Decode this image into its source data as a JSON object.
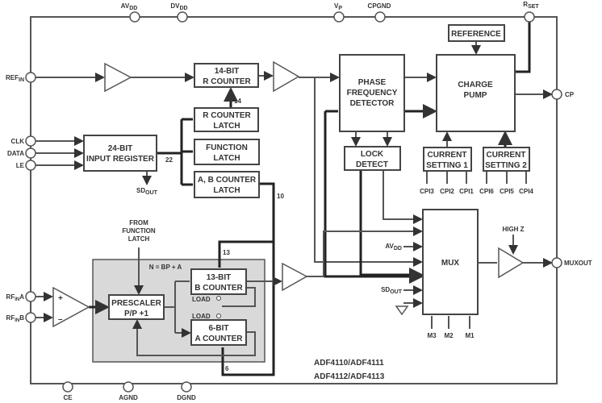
{
  "pins": {
    "avdd": {
      "main": "AV",
      "sub": "DD"
    },
    "dvdd": {
      "main": "DV",
      "sub": "DD"
    },
    "vp": {
      "main": "V",
      "sub": "P"
    },
    "cpgnd": "CPGND",
    "rset": {
      "main": "R",
      "sub": "SET"
    },
    "refin": {
      "main": "REF",
      "sub": "IN"
    },
    "clk": "CLK",
    "data": "DATA",
    "le": "LE",
    "rfina": {
      "main": "RF",
      "sub": "IN",
      "suffix": "A"
    },
    "rfinb": {
      "main": "RF",
      "sub": "IN",
      "suffix": "B"
    },
    "ce": "CE",
    "agnd": "AGND",
    "dgnd": "DGND",
    "cp": "CP",
    "muxout": "MUXOUT"
  },
  "blocks": {
    "r_counter": [
      "14-BIT",
      "R COUNTER"
    ],
    "r_latch": [
      "R COUNTER",
      "LATCH"
    ],
    "function_latch": [
      "FUNCTION",
      "LATCH"
    ],
    "ab_latch": [
      "A, B COUNTER",
      "LATCH"
    ],
    "input_register": [
      "24-BIT",
      "INPUT REGISTER"
    ],
    "pfd": [
      "PHASE",
      "FREQUENCY",
      "DETECTOR"
    ],
    "charge_pump": [
      "CHARGE",
      "PUMP"
    ],
    "reference": "REFERENCE",
    "lock_detect": [
      "LOCK",
      "DETECT"
    ],
    "current_setting_1": [
      "CURRENT",
      "SETTING 1"
    ],
    "current_setting_2": [
      "CURRENT",
      "SETTING 2"
    ],
    "mux": "MUX",
    "prescaler": [
      "PRESCALER",
      "P/P +1"
    ],
    "b_counter": [
      "13-BIT",
      "B COUNTER"
    ],
    "a_counter": [
      "6-BIT",
      "A COUNTER"
    ]
  },
  "labels": {
    "bus_14": "14",
    "bus_22": "22",
    "bus_10": "10",
    "bus_13": "13",
    "bus_6": "6",
    "sdout_reg": {
      "main": "SD",
      "sub": "OUT"
    },
    "sdout_mux": {
      "main": "SD",
      "sub": "OUT"
    },
    "avdd_mux": {
      "main": "AV",
      "sub": "DD"
    },
    "cpi": [
      "CPI3",
      "CPI2",
      "CPI1",
      "CPI6",
      "CPI5",
      "CPI4"
    ],
    "m": [
      "M3",
      "M2",
      "M1"
    ],
    "high_z": "HIGH Z",
    "from_function_latch": [
      "FROM",
      "FUNCTION",
      "LATCH"
    ],
    "n_formula": "N = BP + A",
    "load1": "LOAD",
    "load2": "LOAD",
    "amp_plus": "+",
    "amp_minus": "–",
    "part_numbers": [
      "ADF4110/ADF4111",
      "ADF4112/ADF4113"
    ]
  },
  "colors": {
    "prescaler_region": "#d9d9d9",
    "line": "#444444"
  }
}
